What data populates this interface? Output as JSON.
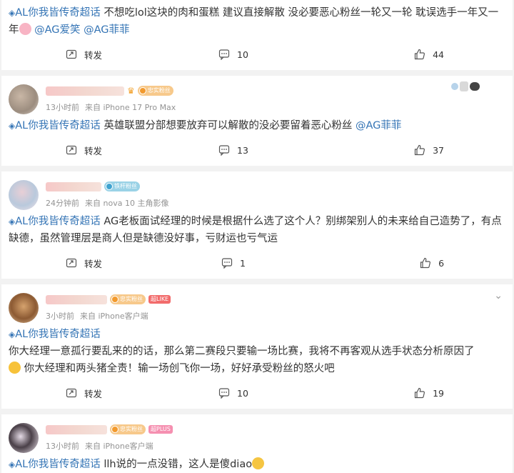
{
  "cards": [
    {
      "topic": "AL你我皆传奇超话",
      "text": " 不想吃lol这块的肉和蛋糕 建议直接解散 没必要恶心粉丝一轮又一轮 耽误选手一年又一年",
      "emoji_after": "pig-emoji",
      "mentions": [
        "@AG爱笑",
        "@AG菲菲"
      ],
      "repost_label": "转发",
      "comment_count": "10",
      "like_count": "44"
    },
    {
      "time": "13小时前",
      "source": "来自 iPhone 17 Pro Max",
      "fan_badge": "忠实粉丝",
      "topic": "AL你我皆传奇超话",
      "text": " 英雄联盟分部想要放弃可以解散的没必要留着恶心粉丝 ",
      "mentions": [
        "@AG菲菲"
      ],
      "repost_label": "转发",
      "comment_count": "13",
      "like_count": "37"
    },
    {
      "time": "24分钟前",
      "source": "来自 nova 10 主角影像",
      "fan_badge": "铁杆粉丝",
      "topic": "AL你我皆传奇超话",
      "text": " AG老板面试经理的时候是根据什么选了这个人？别绑架别人的未来给自己造势了，有点缺德，虽然管理层是商人但是缺德没好事，亏财运也亏气运",
      "repost_label": "转发",
      "comment_count": "1",
      "like_count": "6"
    },
    {
      "time": "3小时前",
      "source": "来自 iPhone客户端",
      "fan_badge": "忠实粉丝",
      "level_badge": "超LIKE",
      "topic": "AL你我皆传奇超话",
      "text_line1": "你大经理一意孤行要乱来的的话，那么第二赛段只要输一场比赛，我将不再客观从选手状态分析原因了",
      "text_line2": " 你大经理和两头猪全责！输一场创飞你一场，好好承受粉丝的怒火吧",
      "repost_label": "转发",
      "comment_count": "10",
      "like_count": "19"
    },
    {
      "time": "13小时前",
      "source": "来自 iPhone客户端",
      "fan_badge": "忠实粉丝",
      "level_badge": "超PLUS",
      "topic": "AL你我皆传奇超话",
      "text": " llh说的一点没错，这人是傻diao",
      "emoji_after": "crying-emoji"
    }
  ],
  "colors": {
    "link": "#3474b5",
    "meta": "#939393",
    "background": "#f2f2f2"
  }
}
